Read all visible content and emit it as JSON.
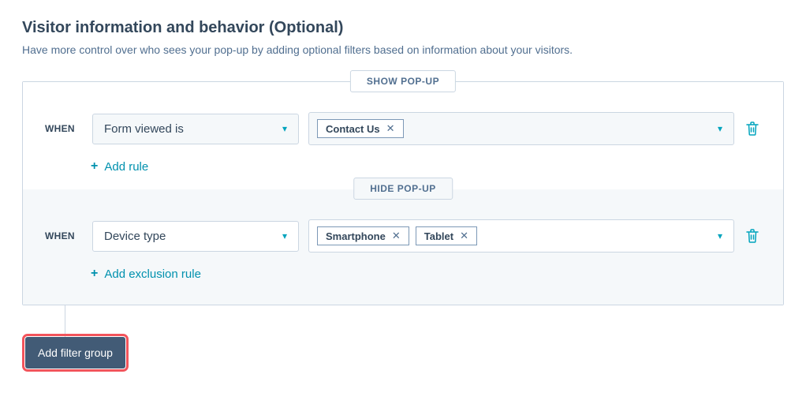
{
  "header": {
    "title": "Visitor information and behavior (Optional)",
    "subtitle": "Have more control over who sees your pop-up by adding optional filters based on information about your visitors."
  },
  "sections": {
    "show": {
      "tab_label": "SHOW POP-UP",
      "when_label": "WHEN",
      "rule": {
        "dropdown_value": "Form viewed is",
        "tags": [
          "Contact Us"
        ]
      },
      "add_link_label": "Add rule"
    },
    "hide": {
      "tab_label": "HIDE POP-UP",
      "when_label": "WHEN",
      "rule": {
        "dropdown_value": "Device type",
        "tags": [
          "Smartphone",
          "Tablet"
        ]
      },
      "add_link_label": "Add exclusion rule"
    }
  },
  "footer": {
    "add_filter_group_label": "Add filter group"
  }
}
